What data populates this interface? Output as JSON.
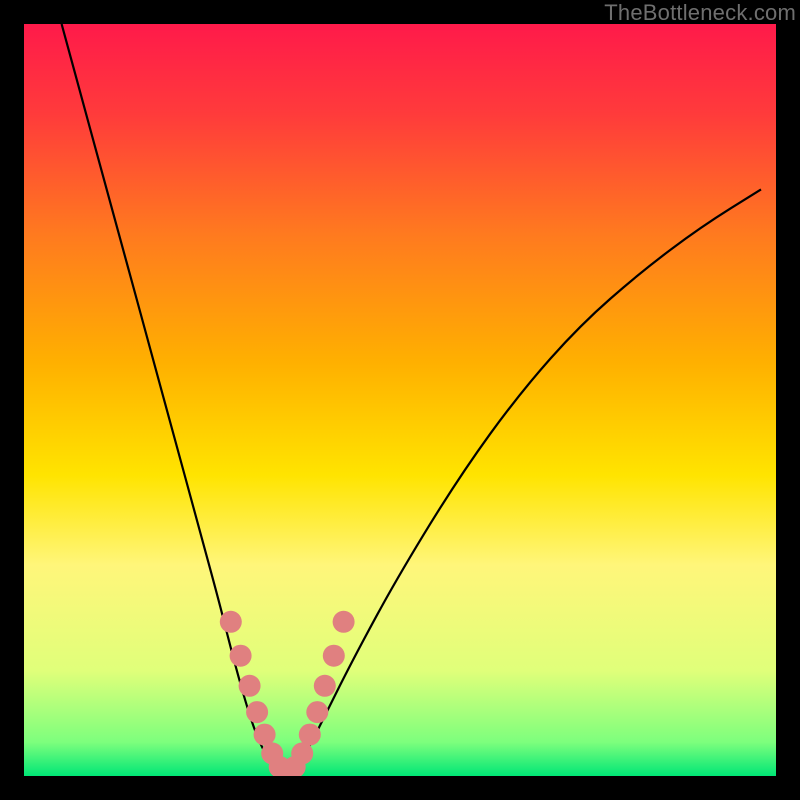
{
  "watermark": "TheBottleneck.com",
  "gradient_stops": [
    {
      "offset": 0.0,
      "color": "#ff1a4a"
    },
    {
      "offset": 0.12,
      "color": "#ff3b3b"
    },
    {
      "offset": 0.28,
      "color": "#ff7a1f"
    },
    {
      "offset": 0.45,
      "color": "#ffb000"
    },
    {
      "offset": 0.6,
      "color": "#ffe400"
    },
    {
      "offset": 0.72,
      "color": "#fff67a"
    },
    {
      "offset": 0.86,
      "color": "#e0ff7a"
    },
    {
      "offset": 0.955,
      "color": "#7dff7d"
    },
    {
      "offset": 1.0,
      "color": "#00e676"
    }
  ],
  "curve_color": "#000000",
  "dot_color": "#e08080",
  "dot_radius": 11,
  "chart_data": {
    "type": "line",
    "title": "",
    "xlabel": "",
    "ylabel": "",
    "xlim": [
      0,
      100
    ],
    "ylim": [
      0,
      100
    ],
    "grid": false,
    "series": [
      {
        "name": "bottleneck-curve",
        "x": [
          5,
          8,
          11,
          14,
          17,
          20,
          23,
          26,
          28,
          30,
          31.5,
          33,
          34,
          35,
          36.5,
          38,
          40,
          44,
          50,
          58,
          66,
          74,
          82,
          90,
          98
        ],
        "y": [
          100,
          89,
          78,
          67,
          56,
          45,
          34,
          23,
          15,
          8,
          4,
          1.5,
          0.5,
          0.5,
          1.5,
          4,
          8,
          16,
          27,
          40,
          51,
          60,
          67,
          73,
          78
        ]
      }
    ],
    "annotations": {
      "highlight_dots": {
        "name": "salmon-dots",
        "x": [
          27.5,
          28.8,
          30.0,
          31.0,
          32.0,
          33.0,
          34.0,
          35.0,
          36.0,
          37.0,
          38.0,
          39.0,
          40.0,
          41.2,
          42.5
        ],
        "y": [
          20.5,
          16.0,
          12.0,
          8.5,
          5.5,
          3.0,
          1.2,
          0.6,
          1.2,
          3.0,
          5.5,
          8.5,
          12.0,
          16.0,
          20.5
        ]
      }
    }
  }
}
